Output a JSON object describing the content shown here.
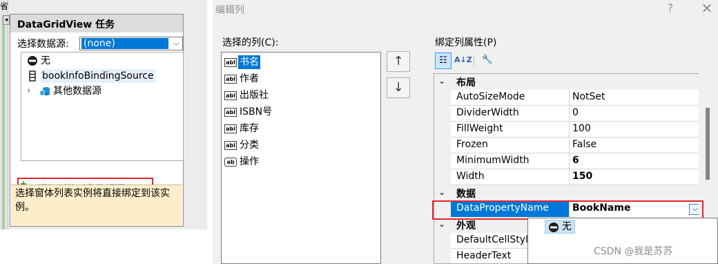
{
  "left": {
    "ruler_char": "省",
    "title": "DataGridView 任务",
    "ds_label": "选择数据源:",
    "ds_value": "(none)",
    "tree": [
      {
        "label": "无",
        "icon": "no-entry-icon"
      },
      {
        "label": "bookInfoBindingSource",
        "icon": "binding-source-icon"
      },
      {
        "label": "其他数据源",
        "icon": "data-sources-icon"
      }
    ],
    "add_link": "添加新的对象数据源...",
    "description": "选择窗体列表实例将直接绑定到该实例。"
  },
  "dialog": {
    "title": "编辑列",
    "help": "?",
    "close": "✕",
    "selected_columns_label": "选择的列(C):",
    "columns": [
      {
        "label": "书名",
        "icon": "abl",
        "selected": true
      },
      {
        "label": "作者",
        "icon": "abl"
      },
      {
        "label": "出版社",
        "icon": "abl"
      },
      {
        "label": "ISBN号",
        "icon": "abl"
      },
      {
        "label": "库存",
        "icon": "abl"
      },
      {
        "label": "分类",
        "icon": "abl"
      },
      {
        "label": "操作",
        "icon": "ab"
      }
    ],
    "up_arrow": "↑",
    "down_arrow": "↓",
    "bound_props_label": "绑定列属性(P)",
    "property_grid": {
      "categories": [
        {
          "name": "布局",
          "rows": [
            {
              "name": "AutoSizeMode",
              "value": "NotSet"
            },
            {
              "name": "DividerWidth",
              "value": "0"
            },
            {
              "name": "FillWeight",
              "value": "100"
            },
            {
              "name": "Frozen",
              "value": "False"
            },
            {
              "name": "MinimumWidth",
              "value": "6",
              "bold": true
            },
            {
              "name": "Width",
              "value": "150",
              "bold": true
            }
          ]
        },
        {
          "name": "数据",
          "rows": [
            {
              "name": "DataPropertyName",
              "value": "BookName",
              "bold": true,
              "selected": true
            }
          ]
        },
        {
          "name": "外观",
          "rows": [
            {
              "name": "DefaultCellStyl",
              "value": ""
            },
            {
              "name": "HeaderText",
              "value": ""
            }
          ]
        }
      ]
    },
    "dropdown_item": "无"
  },
  "watermark": "CSDN @我是苏苏",
  "colors": {
    "selection": "#0078d7",
    "highlight_box": "#e6232b",
    "link": "#1b6ac9",
    "info_bg": "#fdeecb"
  }
}
